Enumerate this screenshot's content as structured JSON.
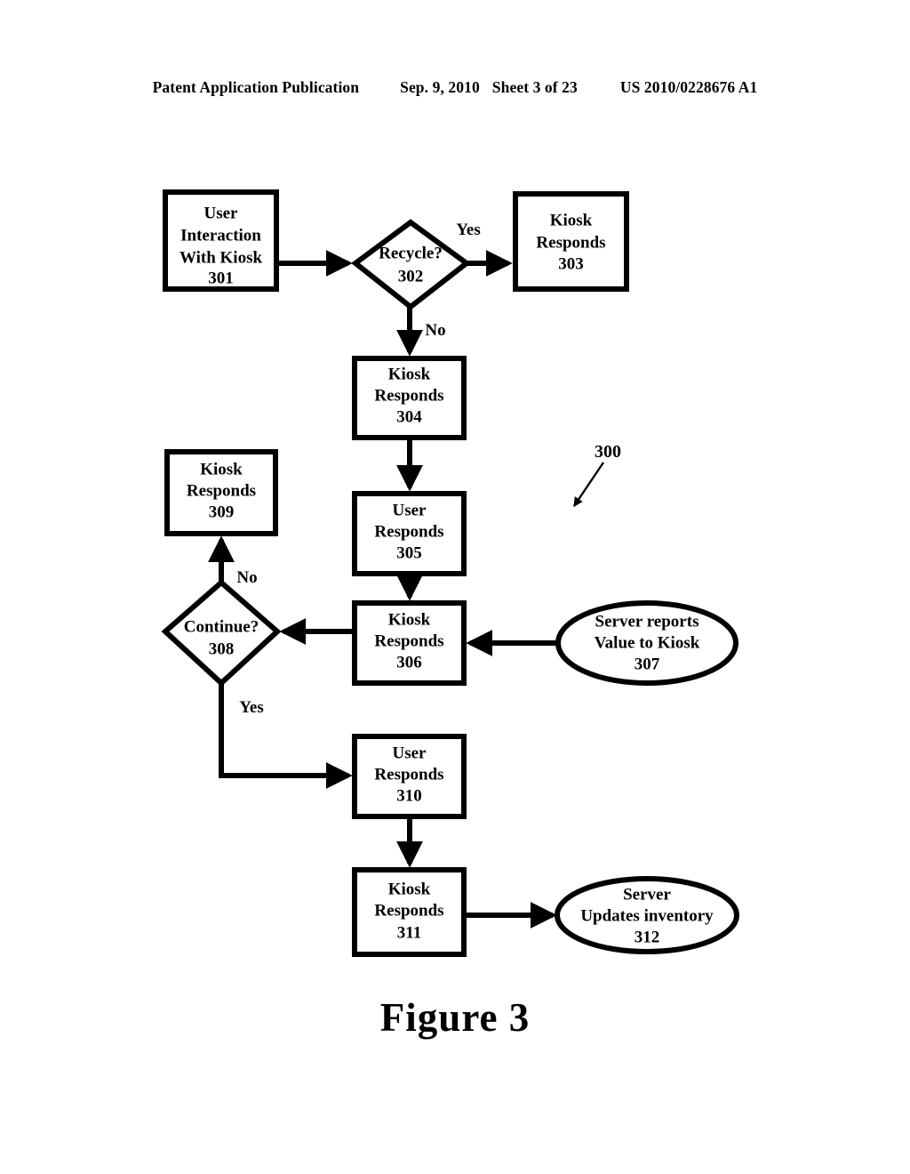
{
  "header": {
    "publication": "Patent Application Publication",
    "date": "Sep. 9, 2010",
    "sheet": "Sheet 3 of 23",
    "patent_number": "US 2010/0228676 A1"
  },
  "figure": {
    "caption": "Figure 3",
    "diagram_reference": "300"
  },
  "nodes": {
    "n301": {
      "line1": "User",
      "line2": "Interaction",
      "line3": "With Kiosk",
      "ref": "301",
      "shape": "rectangle"
    },
    "n302": {
      "line1": "Recycle?",
      "ref": "302",
      "shape": "diamond"
    },
    "n303": {
      "line1": "Kiosk",
      "line2": "Responds",
      "ref": "303",
      "shape": "rectangle"
    },
    "n304": {
      "line1": "Kiosk",
      "line2": "Responds",
      "ref": "304",
      "shape": "rectangle"
    },
    "n305": {
      "line1": "User",
      "line2": "Responds",
      "ref": "305",
      "shape": "rectangle"
    },
    "n306": {
      "line1": "Kiosk",
      "line2": "Responds",
      "ref": "306",
      "shape": "rectangle"
    },
    "n307": {
      "line1": "Server reports",
      "line2": "Value to Kiosk",
      "ref": "307",
      "shape": "ellipse"
    },
    "n308": {
      "line1": "Continue?",
      "ref": "308",
      "shape": "diamond"
    },
    "n309": {
      "line1": "Kiosk",
      "line2": "Responds",
      "ref": "309",
      "shape": "rectangle"
    },
    "n310": {
      "line1": "User",
      "line2": "Responds",
      "ref": "310",
      "shape": "rectangle"
    },
    "n311": {
      "line1": "Kiosk",
      "line2": "Responds",
      "ref": "311",
      "shape": "rectangle"
    },
    "n312": {
      "line1": "Server",
      "line2": "Updates inventory",
      "ref": "312",
      "shape": "ellipse"
    }
  },
  "edge_labels": {
    "recycle_yes": "Yes",
    "recycle_no": "No",
    "continue_no": "No",
    "continue_yes": "Yes"
  }
}
